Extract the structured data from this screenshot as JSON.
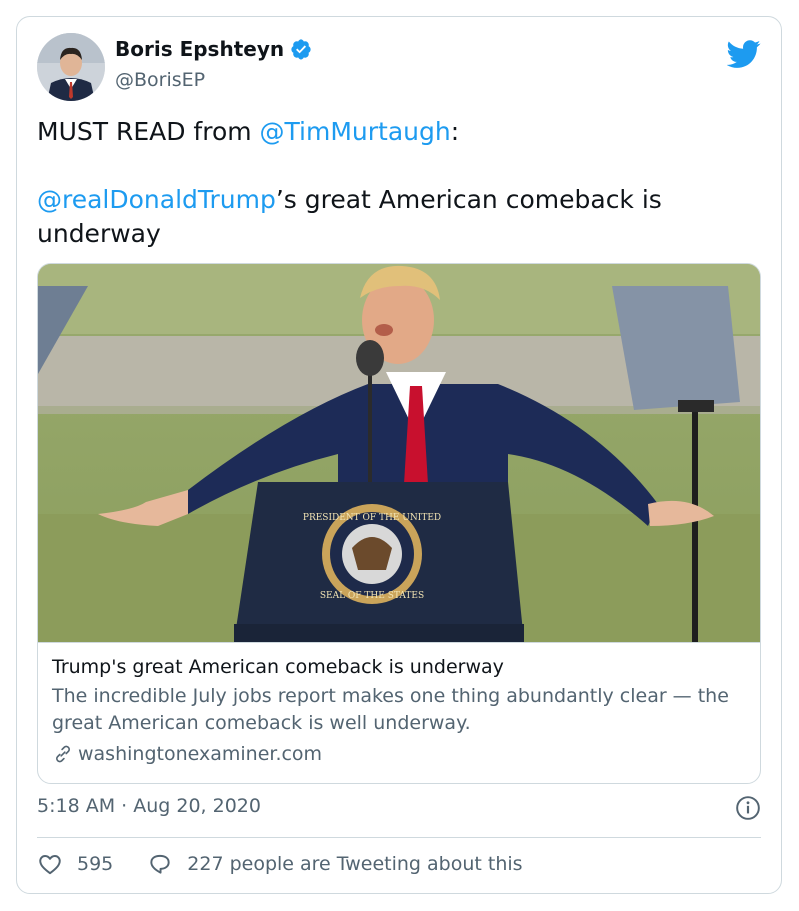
{
  "author": {
    "name": "Boris Epshteyn",
    "handle": "@BorisEP",
    "verified": true
  },
  "tweet": {
    "line1_prefix": "MUST READ from ",
    "line1_mention": "@TimMurtaugh",
    "line1_suffix": ":",
    "line2_mention": "@realDonaldTrump",
    "line2_suffix": "’s great American comeback is underway"
  },
  "link_card": {
    "title": "Trump's great American comeback is underway",
    "description": "The incredible July jobs report makes one thing abundantly clear — the great American comeback is well underway.",
    "domain": "washingtonexaminer.com",
    "seal_text_top": "PRESIDENT OF THE UNITED",
    "seal_text_bottom": "SEAL OF THE STATES"
  },
  "timestamp": "5:18 AM · Aug 20, 2020",
  "stats": {
    "likes": "595",
    "replies_text": "227 people are Tweeting about this"
  },
  "colors": {
    "accent": "#1d9bf0",
    "text_primary": "#0f1419",
    "text_secondary": "#536471",
    "border": "#cfd9de"
  },
  "icons": [
    "verified-badge-icon",
    "twitter-bird-icon",
    "link-icon",
    "info-icon",
    "heart-icon",
    "reply-bubble-icon"
  ]
}
